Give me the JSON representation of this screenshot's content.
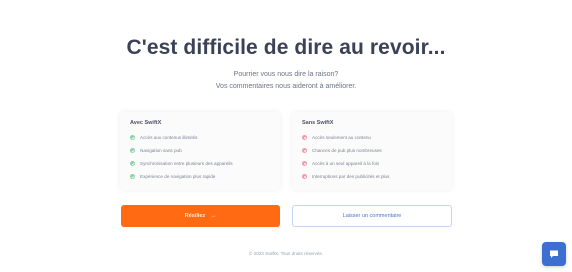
{
  "header": {
    "title": "C'est difficile de dire au revoir...",
    "subtitle_line1": "Pourrier vous nous dire la raison?",
    "subtitle_line2": "Vos commentaires nous aideront à améliorer."
  },
  "left_card": {
    "title": "Avec SwiftX",
    "items": [
      "Accès aux contenus illimités",
      "Navigation sans pub",
      "Synchronisation entre plusieurs des appareils",
      "Expérience de navigation plus rapide"
    ]
  },
  "right_card": {
    "title": "Sans SwiftX",
    "items": [
      "Accès seulement au contenu",
      "Chances de pub plus nombreuses",
      "Accès à un seul appareil à la fois",
      "Interruptions par des publicités et plus"
    ]
  },
  "actions": {
    "primary_label": "Résiliez",
    "primary_arrow": "→",
    "secondary_label": "Laisser un commentaire"
  },
  "footer": {
    "text": "© 2023 SwiftX. Tous droits réservés."
  },
  "colors": {
    "accent": "#ff6a13",
    "secondary_text": "#4a74c9",
    "check": "#8ad3a4",
    "cross": "#f19aa7",
    "chat": "#3d6fd1"
  },
  "icons": {
    "check": "check-icon",
    "cross": "x-icon",
    "chat": "chat-icon"
  }
}
